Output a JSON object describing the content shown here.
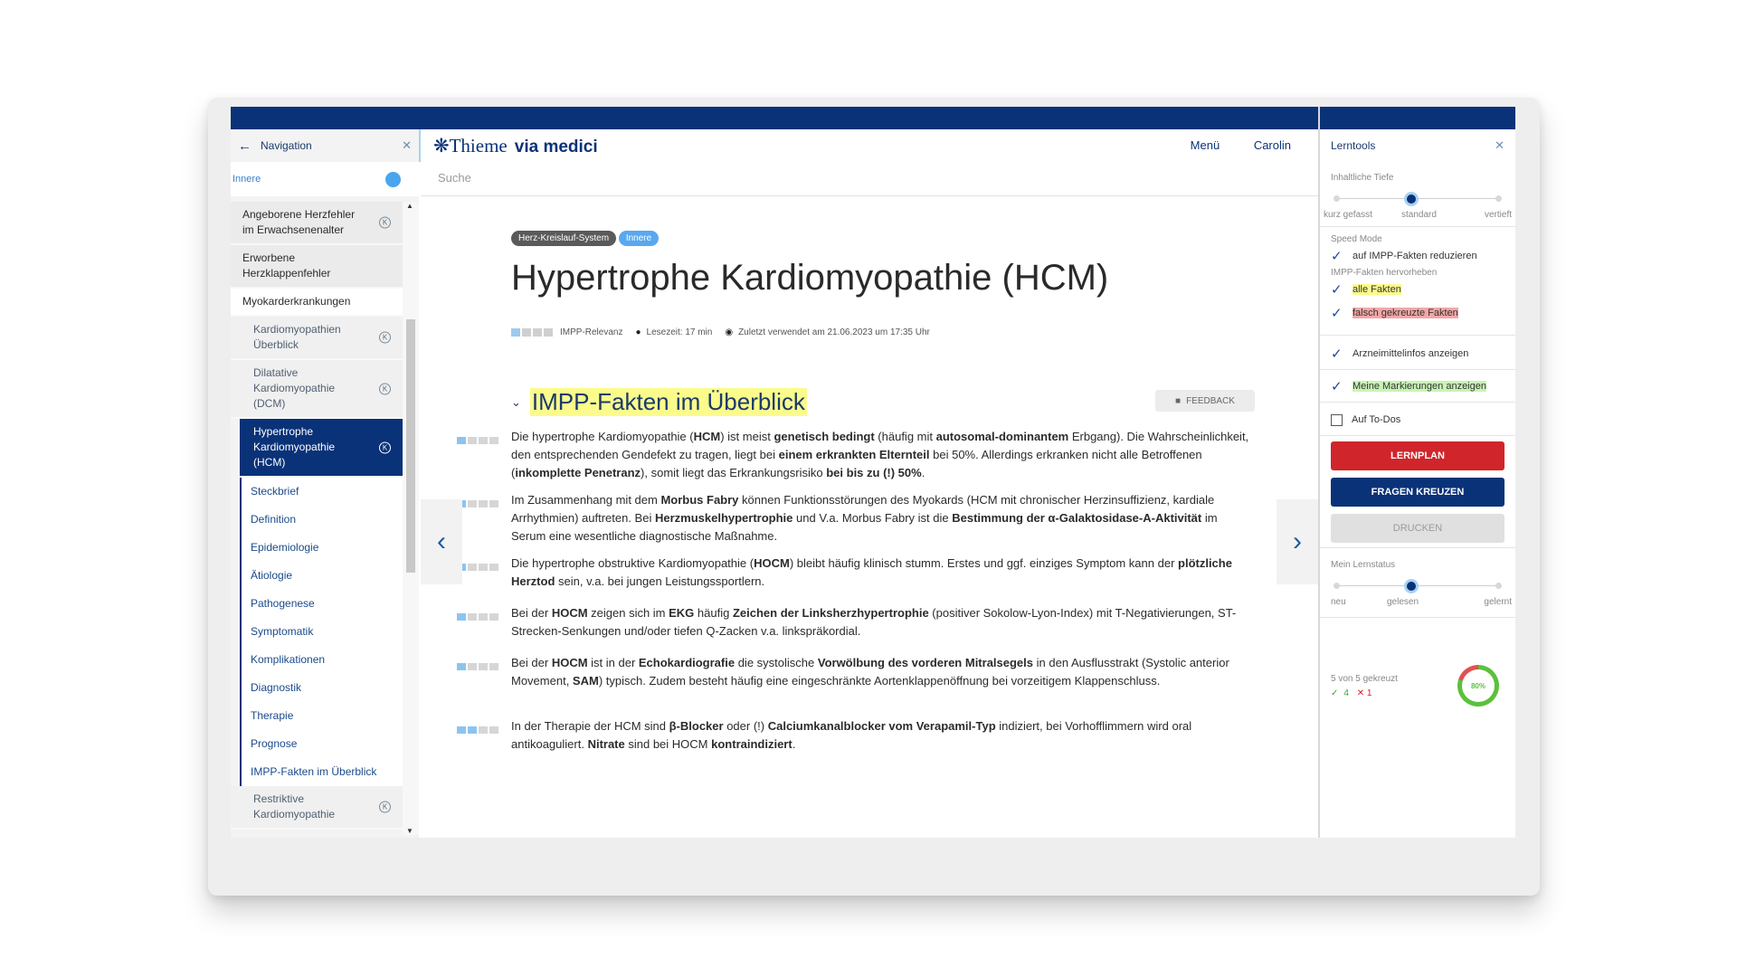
{
  "nav": {
    "title": "Navigation",
    "search_value": "Innere",
    "items": [
      {
        "label": "Angeborene Herzfehler im Erwachsenenalter",
        "k": "K"
      },
      {
        "label": "Erworbene Herzklappenfehler"
      },
      {
        "label": "Myokarderkrankungen"
      },
      {
        "label": "Kardiomyopathien Überblick",
        "k": "K"
      },
      {
        "label": "Dilatative Kardiomyopathie (DCM)",
        "k": "K"
      },
      {
        "label": "Hypertrophe Kardiomyopathie (HCM)",
        "k": "K"
      },
      {
        "label": "Restriktive Kardiomyopathie",
        "k": "K"
      }
    ],
    "anchors": [
      "Steckbrief",
      "Definition",
      "Epidemiologie",
      "Ätiologie",
      "Pathogenese",
      "Symptomatik",
      "Komplikationen",
      "Diagnostik",
      "Therapie",
      "Prognose",
      "IMPP-Fakten im Überblick"
    ]
  },
  "header": {
    "brand": "Thieme",
    "brand_suffix": "via medici",
    "menu": "Menü",
    "user": "Carolin"
  },
  "main": {
    "search_placeholder": "Suche",
    "tags": [
      "Herz-Kreislauf-System",
      "Innere"
    ],
    "title": "Hypertrophe Kardiomyopathie (HCM)",
    "meta": {
      "relevance": "IMPP-Relevanz",
      "reading_time": "Lesezeit: 17 min",
      "last_used": "Zuletzt verwendet am 21.06.2023 um 17:35 Uhr"
    },
    "section_title": "IMPP-Fakten im Überblick",
    "feedback": "FEEDBACK",
    "facts": [
      {
        "level": 1,
        "html": "Die hypertrophe Kardiomyopathie (<b>HCM</b>) ist meist <b>genetisch bedingt</b> (häufig mit <b>autosomal-dominantem</b> Erbgang). Die Wahrscheinlichkeit, den entsprechenden Gendefekt zu tragen, liegt bei <b>einem erkrankten Elternteil</b> bei 50%. Allerdings erkranken nicht alle Betroffenen (<b>inkomplette Penetranz</b>), somit liegt das Erkrankungsrisiko <b>bei bis zu (!) 50%</b>."
      },
      {
        "level": 1,
        "html": "Im Zusammenhang mit dem <b>Morbus Fabry</b> können Funktionsstörungen des Myokards (HCM mit chronischer Herzinsuffizienz, kardiale Arrhythmien) auftreten. Bei <b>Herzmuskelhypertrophie</b> und V.a. Morbus Fabry ist die <b>Bestimmung der α-Galaktosidase-A-Aktivität</b> im Serum eine wesentliche diagnostische Maßnahme."
      },
      {
        "level": 1,
        "html": "Die hypertrophe obstruktive Kardiomyopathie (<b>HOCM</b>) bleibt häufig klinisch stumm. Erstes und ggf. einziges Symptom kann der <b>plötzliche Herztod</b> sein, v.a. bei jungen Leistungssportlern."
      },
      {
        "level": 1,
        "html": "Bei der <b>HOCM</b> zeigen sich im <b>EKG</b> häufig <b>Zeichen der Linksherzhypertrophie</b> (positiver Sokolow-Lyon-Index) mit T-Negativierungen, ST-Strecken-Senkungen und/oder tiefen Q-Zacken v.a. linkspräkordial."
      },
      {
        "level": 1,
        "html": "Bei der <b>HOCM</b> ist in der <b>Echokardiografie</b> die systolische <b>Vorwölbung des vorderen Mitralsegels</b> in den Ausflusstrakt (Systolic anterior Movement, <b>SAM</b>) typisch. Zudem besteht häufig eine eingeschränkte Aortenklappenöffnung bei vorzeitigem Klappenschluss."
      },
      {
        "level": 2,
        "html": "In der Therapie der HCM sind <b>β-Blocker</b> oder (!) <b>Calciumkanalblocker vom Verapamil-Typ</b> indiziert, bei Vorhofflimmern wird oral antikoaguliert. <b>Nitrate</b> sind bei HOCM <b>kontraindiziert</b>."
      }
    ]
  },
  "tools": {
    "title": "Lerntools",
    "depth_label": "Inhaltliche Tiefe",
    "depth_options": [
      "kurz gefasst",
      "standard",
      "vertieft"
    ],
    "depth_selected": "standard",
    "speed_label": "Speed Mode",
    "speed_option": "auf IMPP-Fakten reduzieren",
    "highlight_label": "IMPP-Fakten hervorheben",
    "all_facts": "alle Fakten",
    "wrong_facts": "falsch gekreuzte Fakten",
    "drug_info": "Arzneimittelinfos anzeigen",
    "my_marks": "Meine Markierungen anzeigen",
    "todo": "Auf To-Dos",
    "btn_lernplan": "LERNPLAN",
    "btn_fragen": "FRAGEN KREUZEN",
    "btn_drucken": "DRUCKEN",
    "status_label": "Mein Lernstatus",
    "status_options": [
      "neu",
      "gelesen",
      "gelernt"
    ],
    "status_selected": "gelesen",
    "stats_text": "5 von 5 gekreuzt",
    "correct": "4",
    "wrong": "1",
    "ring_label": "80%",
    "ring_fraction": 0.8,
    "colors": {
      "navy": "#0a3278",
      "light_blue": "#a7d3f3",
      "red": "#d0252b",
      "green": "#5cc03c"
    }
  }
}
